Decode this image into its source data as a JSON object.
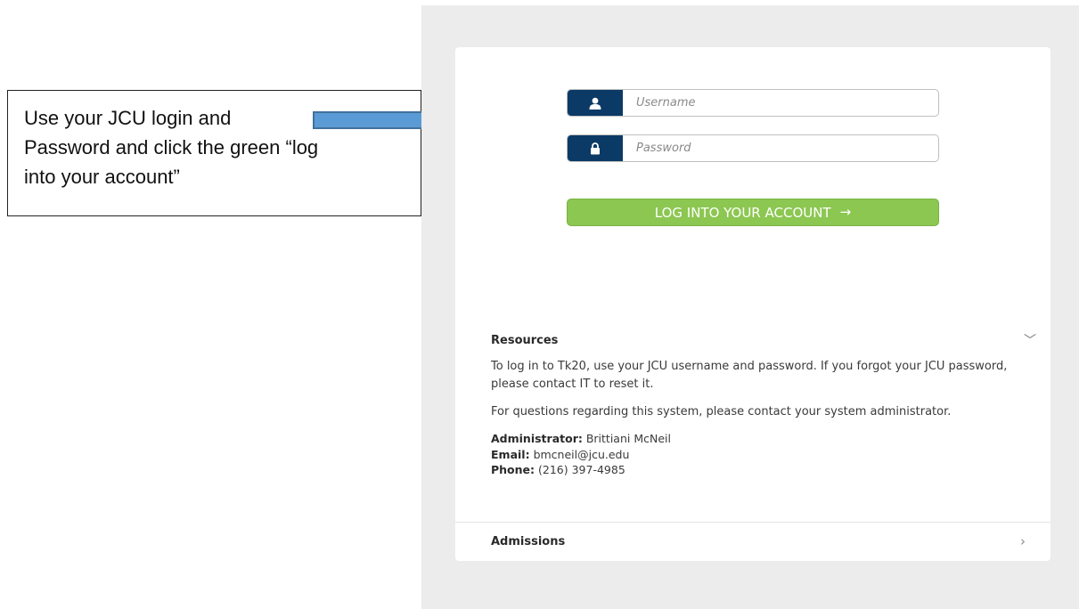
{
  "annotation": {
    "line1": "Use your JCU login and",
    "line2": "Password and click the green “log",
    "line3": "into your account”"
  },
  "login": {
    "username_placeholder": "Username",
    "password_placeholder": "Password",
    "button_label": "LOG INTO YOUR ACCOUNT",
    "button_arrow": "→"
  },
  "resources": {
    "heading": "Resources",
    "toggle_glyph": "﹀",
    "para1": "To log in to Tk20, use your JCU username and password. If you forgot your JCU password, please contact IT to reset it.",
    "para2": "For questions regarding this system, please contact your system administrator.",
    "admin_label": "Administrator:",
    "admin_value": "Brittiani McNeil",
    "email_label": "Email:",
    "email_value": "bmcneil@jcu.edu",
    "phone_label": "Phone:",
    "phone_value": "(216) 397-4985"
  },
  "admissions": {
    "heading": "Admissions",
    "toggle_glyph": "›"
  },
  "colors": {
    "addon": "#0b3a66",
    "button": "#8cc751",
    "arrow_fill": "#5b9bd5",
    "arrow_stroke": "#41719c",
    "backdrop": "#ececec"
  }
}
